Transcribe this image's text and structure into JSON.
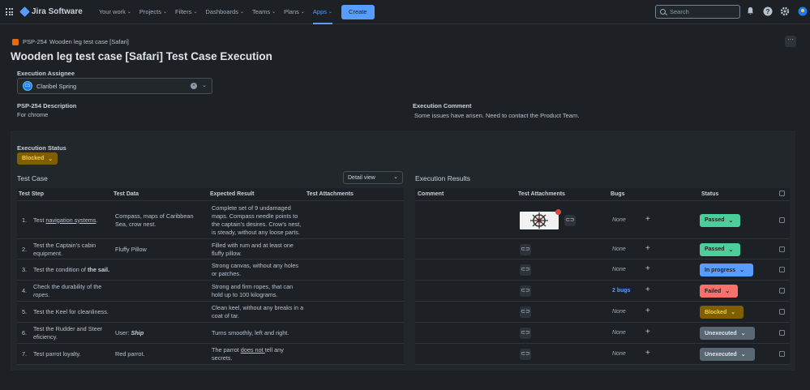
{
  "nav": {
    "product": "Jira Software",
    "items": [
      {
        "label": "Your work",
        "chev": "⌄"
      },
      {
        "label": "Projects",
        "chev": "⌄"
      },
      {
        "label": "Filters",
        "chev": "⌄"
      },
      {
        "label": "Dashboards",
        "chev": "⌄"
      },
      {
        "label": "Teams",
        "chev": "⌄"
      },
      {
        "label": "Plans",
        "chev": "⌄"
      },
      {
        "label": "Apps",
        "chev": "⌄"
      }
    ],
    "create": "Create",
    "search_placeholder": "Search"
  },
  "issue": {
    "breadcrumb_key": "PSP-254",
    "breadcrumb_title": "Wooden leg test case [Safari]",
    "page_title": "Wooden leg test case [Safari] Test Case Execution",
    "more": "···"
  },
  "assignee": {
    "label": "Execution Assignee",
    "initials": "CS",
    "name": "Claribel Spring"
  },
  "description": {
    "label": "PSP-254 Description",
    "value": "For chrome"
  },
  "comment": {
    "label": "Execution Comment",
    "value": "Some issues have arisen. Need to contact the Product Team."
  },
  "execution_status": {
    "label": "Execution Status",
    "value": "Blocked"
  },
  "test_case": {
    "title": "Test Case",
    "view": "Detail view",
    "headers": [
      "Test Step",
      "Test Data",
      "Expected Result",
      "Test Attachments"
    ]
  },
  "results": {
    "title": "Execution Results",
    "headers": [
      "Comment",
      "Test Attachments",
      "Bugs",
      "Status"
    ]
  },
  "rows": [
    {
      "num": "1.",
      "step_pre": "Test ",
      "step_em": "navigation systems",
      "step_post": ".",
      "data": "Compass, maps of Caribbean Sea, crow nest.",
      "expected": "Complete set of 9 undamaged maps. Compass needle points to the captain's desires. Crow's nest, is steady, without any loose parts.",
      "bugs": "None",
      "status": "Passed",
      "status_bg": "#4bce97",
      "status_fg": "#1d2125"
    },
    {
      "num": "2.",
      "step_pre": "Test the Captain's cabin equipment.",
      "step_em": "",
      "step_post": "",
      "data": "Fluffy Pillow",
      "expected": "Filled with rum and at least one fluffy pillow.",
      "bugs": "None",
      "status": "Passed",
      "status_bg": "#4bce97",
      "status_fg": "#1d2125"
    },
    {
      "num": "3.",
      "step_pre": "Test the condition of ",
      "step_em": "the sail.",
      "step_post": "",
      "data": "",
      "expected": "Strong canvas, without any holes or patches.",
      "bugs": "None",
      "status": "In progress",
      "status_bg": "#579dff",
      "status_fg": "#1d2125"
    },
    {
      "num": "4.",
      "step_pre": "Check the durability of the ",
      "step_em": "ropes",
      "step_post": ".",
      "data": "",
      "expected": "Strong and firm ropes, that can hold up to 100 kilograms.",
      "bugs": "2 bugs",
      "status": "Failed",
      "status_bg": "#f87168",
      "status_fg": "#1d2125"
    },
    {
      "num": "5.",
      "step_pre": "Test the Keel for cleanliness.",
      "step_em": "",
      "step_post": "",
      "data": "",
      "expected": "Clean keel, without any breaks in a coat of tar.",
      "bugs": "None",
      "status": "Blocked",
      "status_bg": "#7f5f01",
      "status_fg": "#f5cd47"
    },
    {
      "num": "6.",
      "step_pre": "Test the Rudder and Steer eficiency.",
      "step_em": "",
      "step_post": "",
      "data_pre": "User: ",
      "data_em": "Ship",
      "data": "",
      "expected": "Turns smoothly, left and right.",
      "bugs": "None",
      "status": "Unexecuted",
      "status_bg": "#596773",
      "status_fg": "#dee4ea"
    },
    {
      "num": "7.",
      "step_pre": "Test parrot loyalty.",
      "step_em": "",
      "step_post": "",
      "data": "Red parrot.",
      "expected_pre": "The parrot ",
      "expected_u": "does not ",
      "expected_post": "tell any secrets.",
      "expected": "",
      "bugs": "None",
      "status": "Unexecuted",
      "status_bg": "#596773",
      "status_fg": "#dee4ea"
    }
  ],
  "icons": {
    "attach": "⊂⊃",
    "plus": "+",
    "chevron": "⌄"
  }
}
